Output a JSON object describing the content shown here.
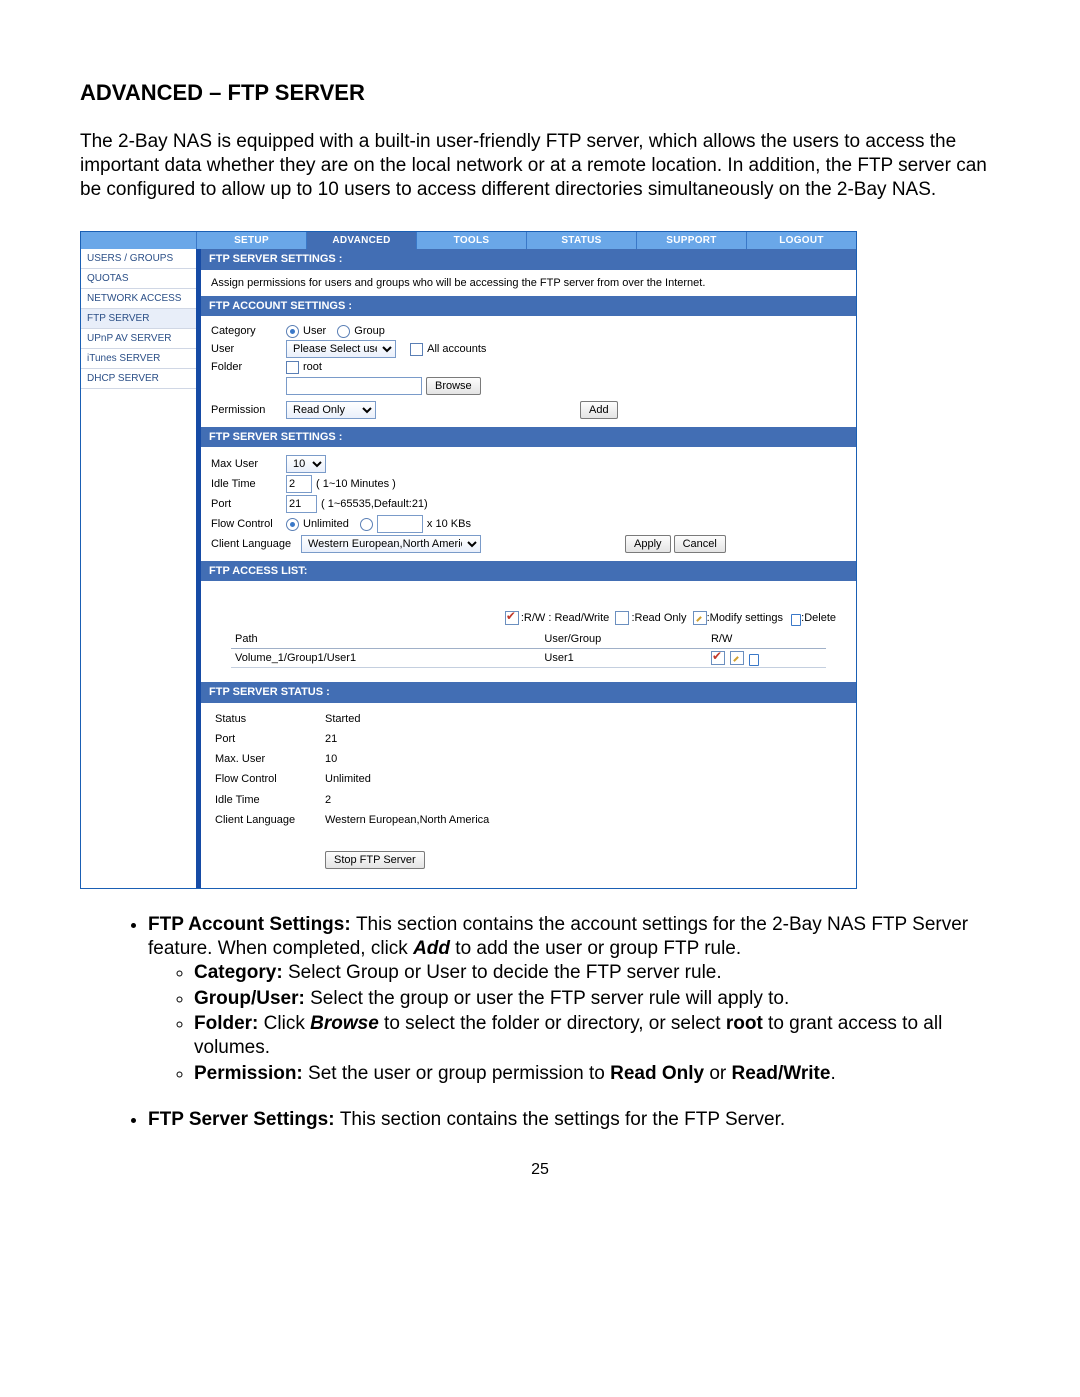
{
  "title": "ADVANCED – FTP SERVER",
  "intro": "The 2-Bay NAS is equipped with a built-in user-friendly FTP server, which allows the users to access the important data whether they are on the local network or at a remote location. In addition, the FTP server can be configured to allow up to 10 users to access different directories simultaneously on the 2-Bay NAS.",
  "tabs": [
    "SETUP",
    "ADVANCED",
    "TOOLS",
    "STATUS",
    "SUPPORT",
    "LOGOUT"
  ],
  "sidebar": [
    "USERS / GROUPS",
    "QUOTAS",
    "NETWORK ACCESS",
    "FTP SERVER",
    "UPnP AV SERVER",
    "iTunes SERVER",
    "DHCP SERVER"
  ],
  "panels": {
    "settings_head": "FTP SERVER SETTINGS :",
    "settings_desc": "Assign permissions for users and groups who will be accessing the FTP server from over the Internet.",
    "account_head": "FTP ACCOUNT SETTINGS :",
    "server_head2": "FTP SERVER SETTINGS :",
    "access_head": "FTP ACCESS LIST:",
    "status_head": "FTP SERVER STATUS :"
  },
  "account": {
    "category_label": "Category",
    "user_radio": "User",
    "group_radio": "Group",
    "user_label": "User",
    "user_select": "Please Select user...",
    "all_accounts": "All accounts",
    "folder_label": "Folder",
    "root": "root",
    "browse": "Browse",
    "permission_label": "Permission",
    "permission_select": "Read Only",
    "add": "Add"
  },
  "server": {
    "max_user_label": "Max User",
    "max_user_value": "10",
    "idle_label": "Idle Time",
    "idle_value": "2",
    "idle_hint": "( 1~10 Minutes )",
    "port_label": "Port",
    "port_value": "21",
    "port_hint": "( 1~65535,Default:21)",
    "flow_label": "Flow Control",
    "unlimited": "Unlimited",
    "flow_unit": "x 10 KBs",
    "lang_label": "Client Language",
    "lang_value": "Western European,North America",
    "apply": "Apply",
    "cancel": "Cancel"
  },
  "access": {
    "legend_rw": ":R/W : Read/Write",
    "legend_ro": ":Read Only",
    "legend_mod": ":Modify settings",
    "legend_del": ":Delete",
    "th_path": "Path",
    "th_user": "User/Group",
    "th_rw": "R/W",
    "row_path": "Volume_1/Group1/User1",
    "row_user": "User1"
  },
  "status": {
    "s_label": "Status",
    "s_val": "Started",
    "p_label": "Port",
    "p_val": "21",
    "m_label": "Max. User",
    "m_val": "10",
    "f_label": "Flow Control",
    "f_val": "Unlimited",
    "i_label": "Idle Time",
    "i_val": "2",
    "l_label": "Client Language",
    "l_val": "Western European,North America",
    "stop_btn": "Stop FTP Server"
  },
  "notes": {
    "b1_bold": "FTP Account Settings: ",
    "b1_text": "This section contains the account settings for the 2-Bay NAS FTP Server feature. When completed, click ",
    "b1_add_bold": "Add",
    "b1_text2": " to add the user or group FTP rule.",
    "cat_bold": "Category:",
    "cat_text": " Select Group or User to decide the FTP server rule.",
    "gu_bold": "Group/User:",
    "gu_text": " Select the group or user the FTP server rule will apply to.",
    "fl_bold": "Folder:",
    "fl_text": " Click ",
    "fl_browse": "Browse",
    "fl_text2": " to select the folder or directory, or select ",
    "fl_root": "root",
    "fl_text3": " to grant access to all volumes.",
    "pm_bold": "Permission:",
    "pm_text": " Set the user or group permission to ",
    "pm_ro": "Read Only",
    "pm_or": " or ",
    "pm_rw": "Read/Write",
    "pm_end": ".",
    "b2_bold": "FTP Server Settings: ",
    "b2_text": "This section contains the settings for the FTP Server."
  },
  "page_num": "25"
}
